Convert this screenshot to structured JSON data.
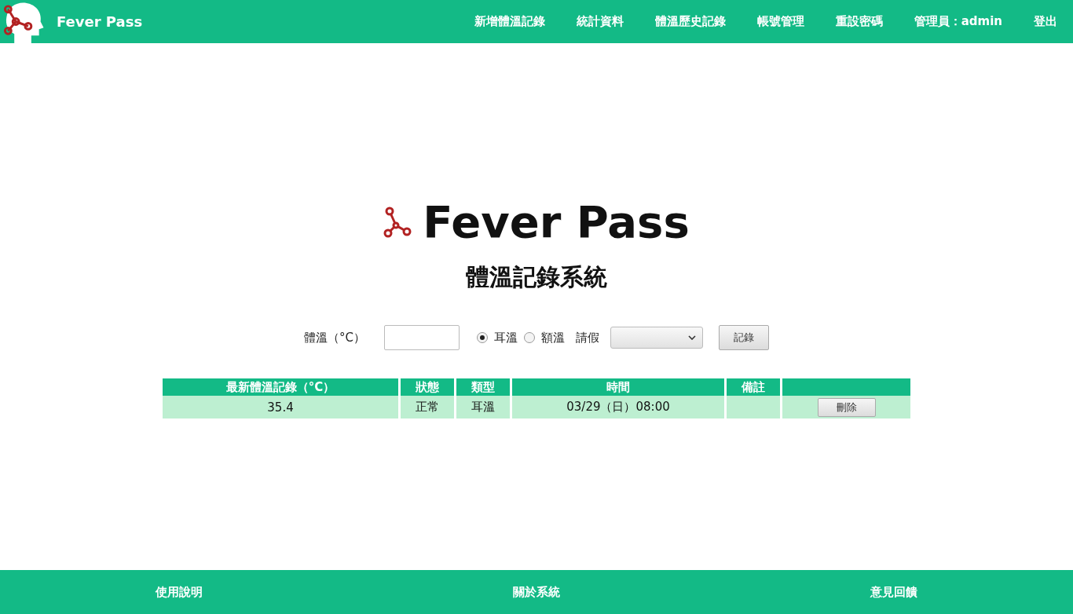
{
  "navbar": {
    "brand": "Fever Pass",
    "items": [
      "新增體溫記錄",
      "統計資料",
      "體溫歷史記錄",
      "帳號管理",
      "重設密碼",
      "管理員：admin",
      "登出"
    ]
  },
  "header": {
    "title": "Fever Pass",
    "subtitle": "體溫記錄系統"
  },
  "form": {
    "temperature_label": "體溫（°C）",
    "options": [
      {
        "label": "耳溫",
        "selected": true
      },
      {
        "label": "額溫",
        "selected": false
      }
    ],
    "leave_label": "請假",
    "submit": "記錄"
  },
  "table": {
    "columns": [
      "最新體溫記錄（°C）",
      "狀態",
      "類型",
      "時間",
      "備註"
    ],
    "rows": [
      {
        "cells": [
          "35.4",
          "正常",
          "耳溫",
          "03/29（日）08:00"
        ],
        "action": "刪除"
      }
    ]
  },
  "footer": [
    "使用說明",
    "關於系統",
    "意見回饋"
  ]
}
